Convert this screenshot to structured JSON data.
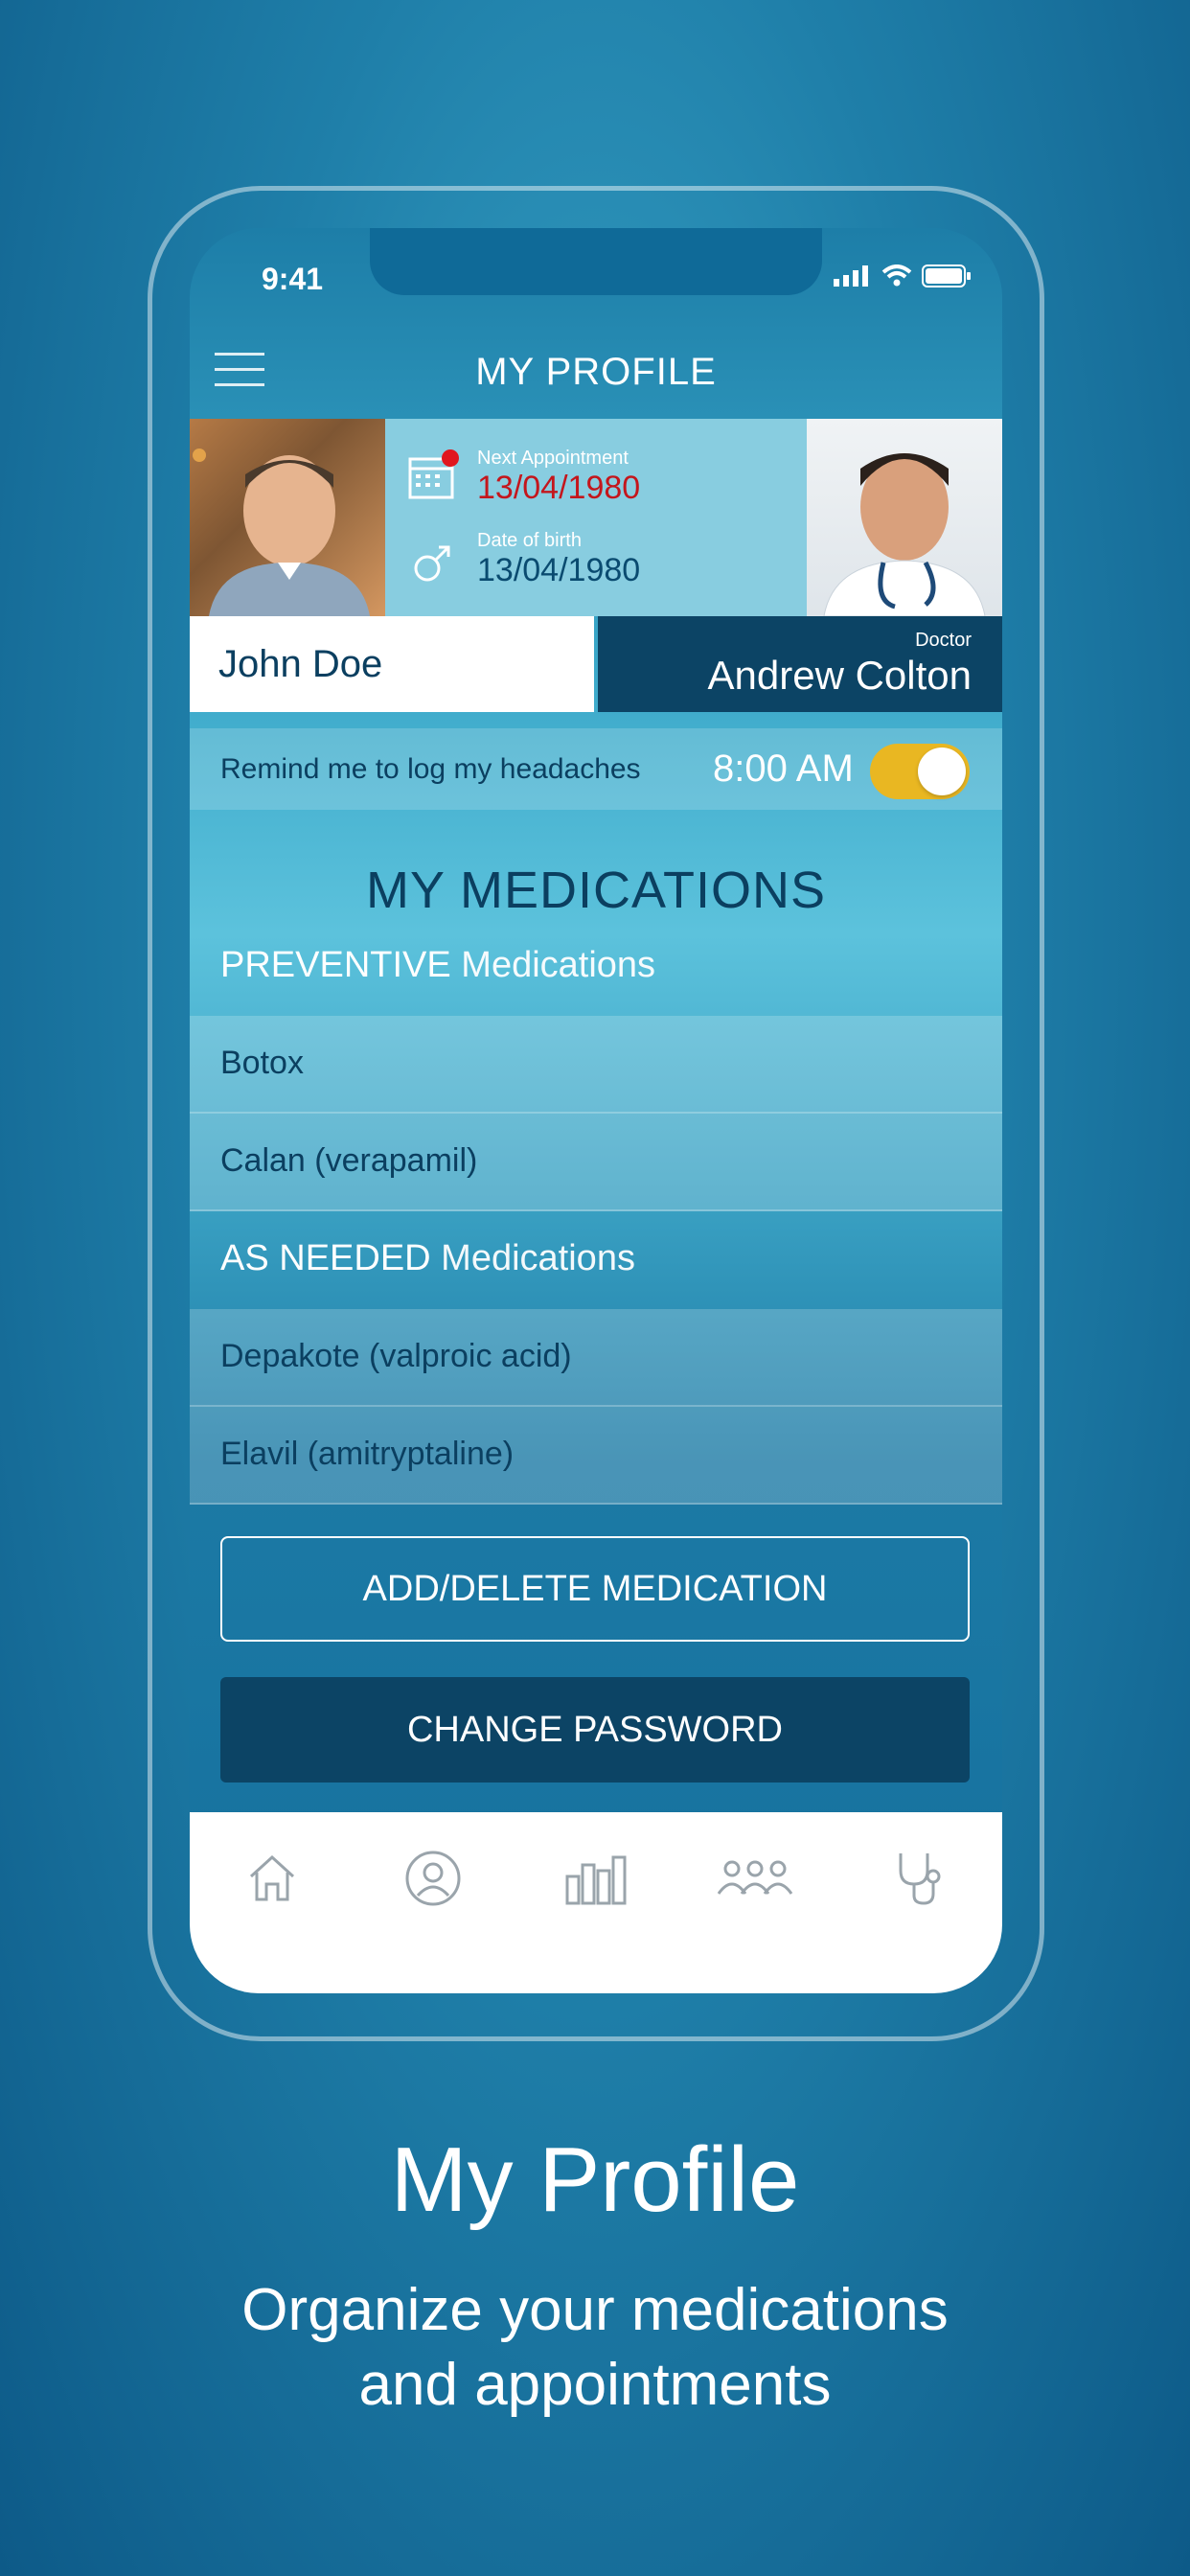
{
  "status": {
    "time": "9:41"
  },
  "header": {
    "title": "MY PROFILE"
  },
  "profile": {
    "next_appointment_label": "Next Appointment",
    "next_appointment_date": "13/04/1980",
    "dob_label": "Date of birth",
    "dob_value": "13/04/1980",
    "patient_name": "John Doe",
    "doctor_role": "Doctor",
    "doctor_name": "Andrew Colton"
  },
  "reminder": {
    "text": "Remind me to log my headaches",
    "time": "8:00 AM",
    "enabled": true
  },
  "medications": {
    "title": "MY MEDICATIONS",
    "preventive_label_bold": "PREVENTIVE",
    "preventive_label_rest": " Medications",
    "preventive": [
      "Botox",
      "Calan (verapamil)"
    ],
    "as_needed_label_bold": "AS NEEDED",
    "as_needed_label_rest": " Medications",
    "as_needed": [
      "Depakote (valproic acid)",
      "Elavil (amitryptaline)"
    ]
  },
  "buttons": {
    "add_delete": "ADD/DELETE MEDICATION",
    "change_password": "CHANGE PASSWORD"
  },
  "tabs": [
    {
      "icon": "home-icon"
    },
    {
      "icon": "profile-icon"
    },
    {
      "icon": "stats-icon"
    },
    {
      "icon": "community-icon"
    },
    {
      "icon": "stethoscope-icon"
    }
  ],
  "marketing": {
    "title": "My Profile",
    "subtitle_line1": "Organize your medications",
    "subtitle_line2": "and appointments"
  },
  "colors": {
    "accent_yellow": "#e9b722",
    "navy": "#0c4465",
    "red": "#c4161c"
  }
}
